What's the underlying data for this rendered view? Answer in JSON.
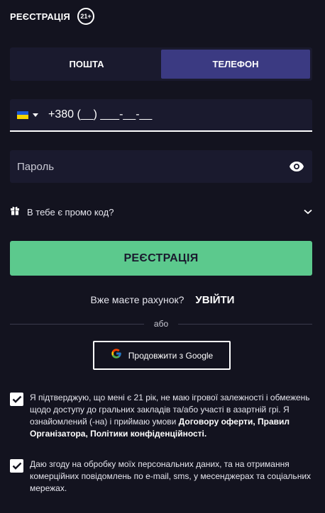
{
  "header": {
    "title": "РЕЄСТРАЦІЯ",
    "age_badge": "21+"
  },
  "tabs": [
    {
      "label": "ПОШТА",
      "active": false
    },
    {
      "label": "ТЕЛЕФОН",
      "active": true
    }
  ],
  "phone": {
    "country_flag": "ukraine-flag",
    "value": "+380 (__) ___-__-__"
  },
  "password": {
    "placeholder": "Пароль",
    "toggle_icon": "eye-icon"
  },
  "promo": {
    "icon": "gift-icon",
    "label": "В тебе є промо код?",
    "chevron_icon": "chevron-down-icon"
  },
  "submit": {
    "label": "РЕЄСТРАЦІЯ",
    "color": "#5cc98d"
  },
  "login": {
    "question": "Вже маєте рахунок?",
    "link": "УВІЙТИ"
  },
  "divider": {
    "text": "або"
  },
  "google": {
    "icon": "google-icon",
    "label": "Продовжити з Google"
  },
  "consents": [
    {
      "checked": true,
      "text": "Я підтверджую, що мені є 21 рік, не маю ігрової залежності і обмежень щодо доступу до гральних закладів та/або участі в азартній грі. Я ознайомлений (-на) і приймаю умови ",
      "bold": "Договору оферти, Правил Організатора, Політики конфіденційності."
    },
    {
      "checked": true,
      "text": "Даю згоду на обробку моїх персональних даних, та на отримання комерційних повідомлень по e-mail, sms, у месенджерах та соціальних мережах."
    }
  ],
  "colors": {
    "background": "#13131f",
    "field": "#1a1a2e",
    "active_tab": "#3b3a82",
    "accent": "#5cc98d"
  }
}
